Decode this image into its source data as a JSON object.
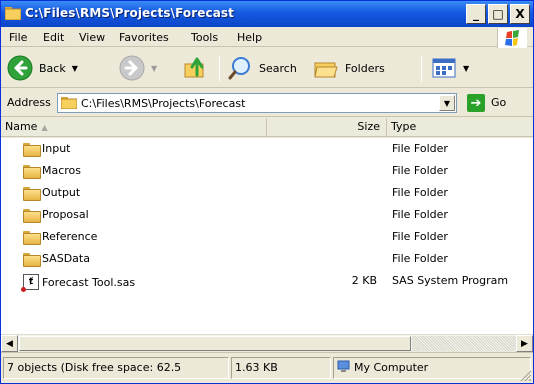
{
  "window": {
    "title": "C:\\Files\\RMS\\Projects\\Forecast",
    "controls": {
      "minimize": "_",
      "maximize": "□",
      "close": "X"
    }
  },
  "menu": {
    "items": [
      {
        "label": "File"
      },
      {
        "label": "Edit"
      },
      {
        "label": "View"
      },
      {
        "label": "Favorites"
      },
      {
        "label": "Tools"
      },
      {
        "label": "Help"
      }
    ]
  },
  "toolbar": {
    "back_label": "Back",
    "search_label": "Search",
    "folders_label": "Folders"
  },
  "address": {
    "label": "Address",
    "value": "C:\\Files\\RMS\\Projects\\Forecast",
    "go_label": "Go"
  },
  "columns": {
    "name": "Name",
    "size": "Size",
    "type": "Type"
  },
  "files": [
    {
      "name": "Input",
      "size": "",
      "type": "File Folder",
      "icon": "folder-icon"
    },
    {
      "name": "Macros",
      "size": "",
      "type": "File Folder",
      "icon": "folder-icon"
    },
    {
      "name": "Output",
      "size": "",
      "type": "File Folder",
      "icon": "folder-icon"
    },
    {
      "name": "Proposal",
      "size": "",
      "type": "File Folder",
      "icon": "folder-icon"
    },
    {
      "name": "Reference",
      "size": "",
      "type": "File Folder",
      "icon": "folder-icon"
    },
    {
      "name": "SASData",
      "size": "",
      "type": "File Folder",
      "icon": "folder-icon"
    },
    {
      "name": "Forecast Tool.sas",
      "size": "2 KB",
      "type": "SAS System Program",
      "icon": "sas-program-icon"
    }
  ],
  "status": {
    "objects": "7 objects (Disk free space: 62.5",
    "size": "1.63 KB",
    "zone": "My Computer"
  },
  "colors": {
    "titlebar": "#0c46c8",
    "go": "#2aa22a",
    "chrome": "#ece9d8"
  }
}
